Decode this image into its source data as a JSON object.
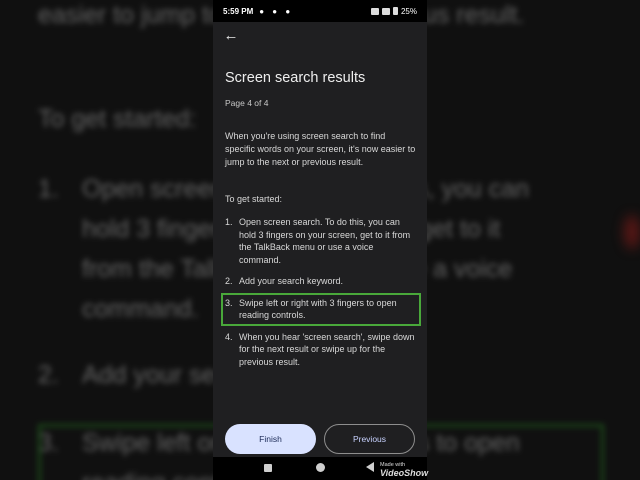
{
  "background": {
    "lines": [
      "easier to jump to the next or previous result.",
      "To get started:",
      "1.",
      "Open screen search. To do this, you can",
      "hold 3 fingers on your screen, get to it",
      "from the TalkBack menu or use a voice",
      "command.",
      "2.",
      "Add your search keyword.",
      "3.",
      "Swipe left or right with 3 fingers to open",
      "reading controls."
    ]
  },
  "status_bar": {
    "time": "5:59 PM",
    "battery": "25%",
    "notifications": "● ● ●"
  },
  "header": {
    "back_icon": "←"
  },
  "title": "Screen search results",
  "page_indicator": "Page 4 of 4",
  "intro": "When you're using screen search to find specific words on your screen, it's now easier to jump to the next or previous result.",
  "getting_started": "To get started:",
  "steps": [
    {
      "num": "1.",
      "text": "Open screen search. To do this, you can hold 3 fingers on your screen, get to it from the TalkBack menu or use a voice command."
    },
    {
      "num": "2.",
      "text": "Add your search keyword."
    },
    {
      "num": "3.",
      "text": "Swipe left or right with 3 fingers to open reading controls."
    },
    {
      "num": "4.",
      "text": "When you hear 'screen search', swipe down for the next result or swipe up for the previous result."
    }
  ],
  "buttons": {
    "finish": "Finish",
    "previous": "Previous"
  },
  "watermark": {
    "small": "Made with",
    "big": "VideoShow"
  },
  "colors": {
    "highlight": "#49a83a",
    "finish_bg": "#d9e2ff",
    "panel_bg": "#1f1f21"
  }
}
